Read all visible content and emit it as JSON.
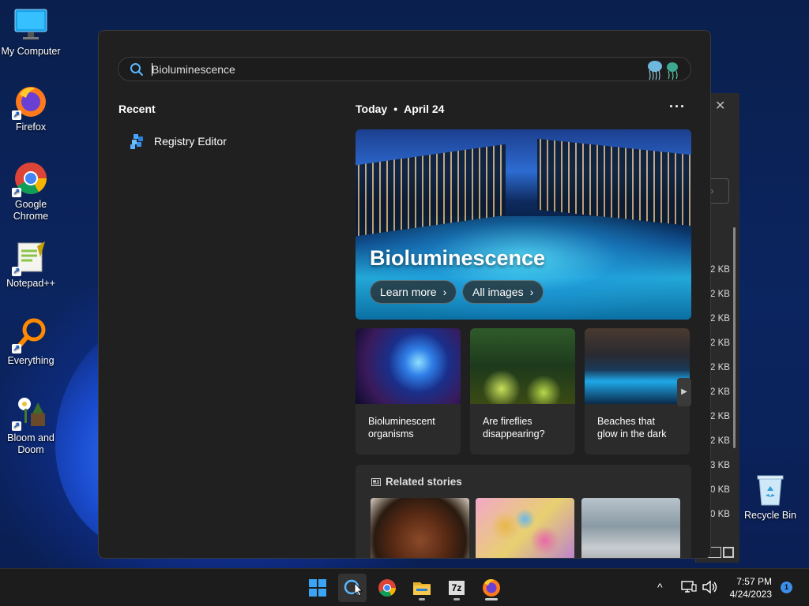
{
  "desktop": {
    "icons": [
      {
        "label": "My Computer"
      },
      {
        "label": "Firefox"
      },
      {
        "label": "Google Chrome"
      },
      {
        "label": "Notepad++"
      },
      {
        "label": "Everything"
      },
      {
        "label": "Bloom and Doom"
      },
      {
        "label": "Recycle Bin"
      }
    ]
  },
  "background_window": {
    "close_glyph": "✕",
    "sizes": [
      "2 KB",
      "2 KB",
      "2 KB",
      "2 KB",
      "2 KB",
      "2 KB",
      "2 KB",
      "2 KB",
      "3 KB",
      "0 KB",
      "0 KB"
    ]
  },
  "search": {
    "query": "Bioluminescence",
    "recent_title": "Recent",
    "recent_items": [
      {
        "label": "Registry Editor",
        "icon": "registry-editor-icon"
      }
    ],
    "today_label": "Today",
    "separator": "•",
    "date_label": "April 24",
    "more_glyph": "···",
    "hero": {
      "title": "Bioluminescence",
      "learn_more": "Learn more",
      "all_images": "All images",
      "chevron": "›"
    },
    "cards": [
      {
        "caption": "Bioluminescent organisms"
      },
      {
        "caption": "Are fireflies disappearing?"
      },
      {
        "caption": "Beaches that glow in the dark"
      }
    ],
    "next_glyph": "▶",
    "related_title": "Related stories"
  },
  "taskbar": {
    "apps": [
      "start-button",
      "search-button",
      "chrome",
      "file-explorer",
      "7zip",
      "firefox"
    ],
    "zip_label": "7z",
    "tray_chevron": "^",
    "time": "7:57 PM",
    "date": "4/24/2023",
    "notification_count": "1"
  },
  "colors": {
    "accent": "#3b8eea",
    "panel_bg": "#202020",
    "taskbar_bg": "#1c1c1c"
  }
}
